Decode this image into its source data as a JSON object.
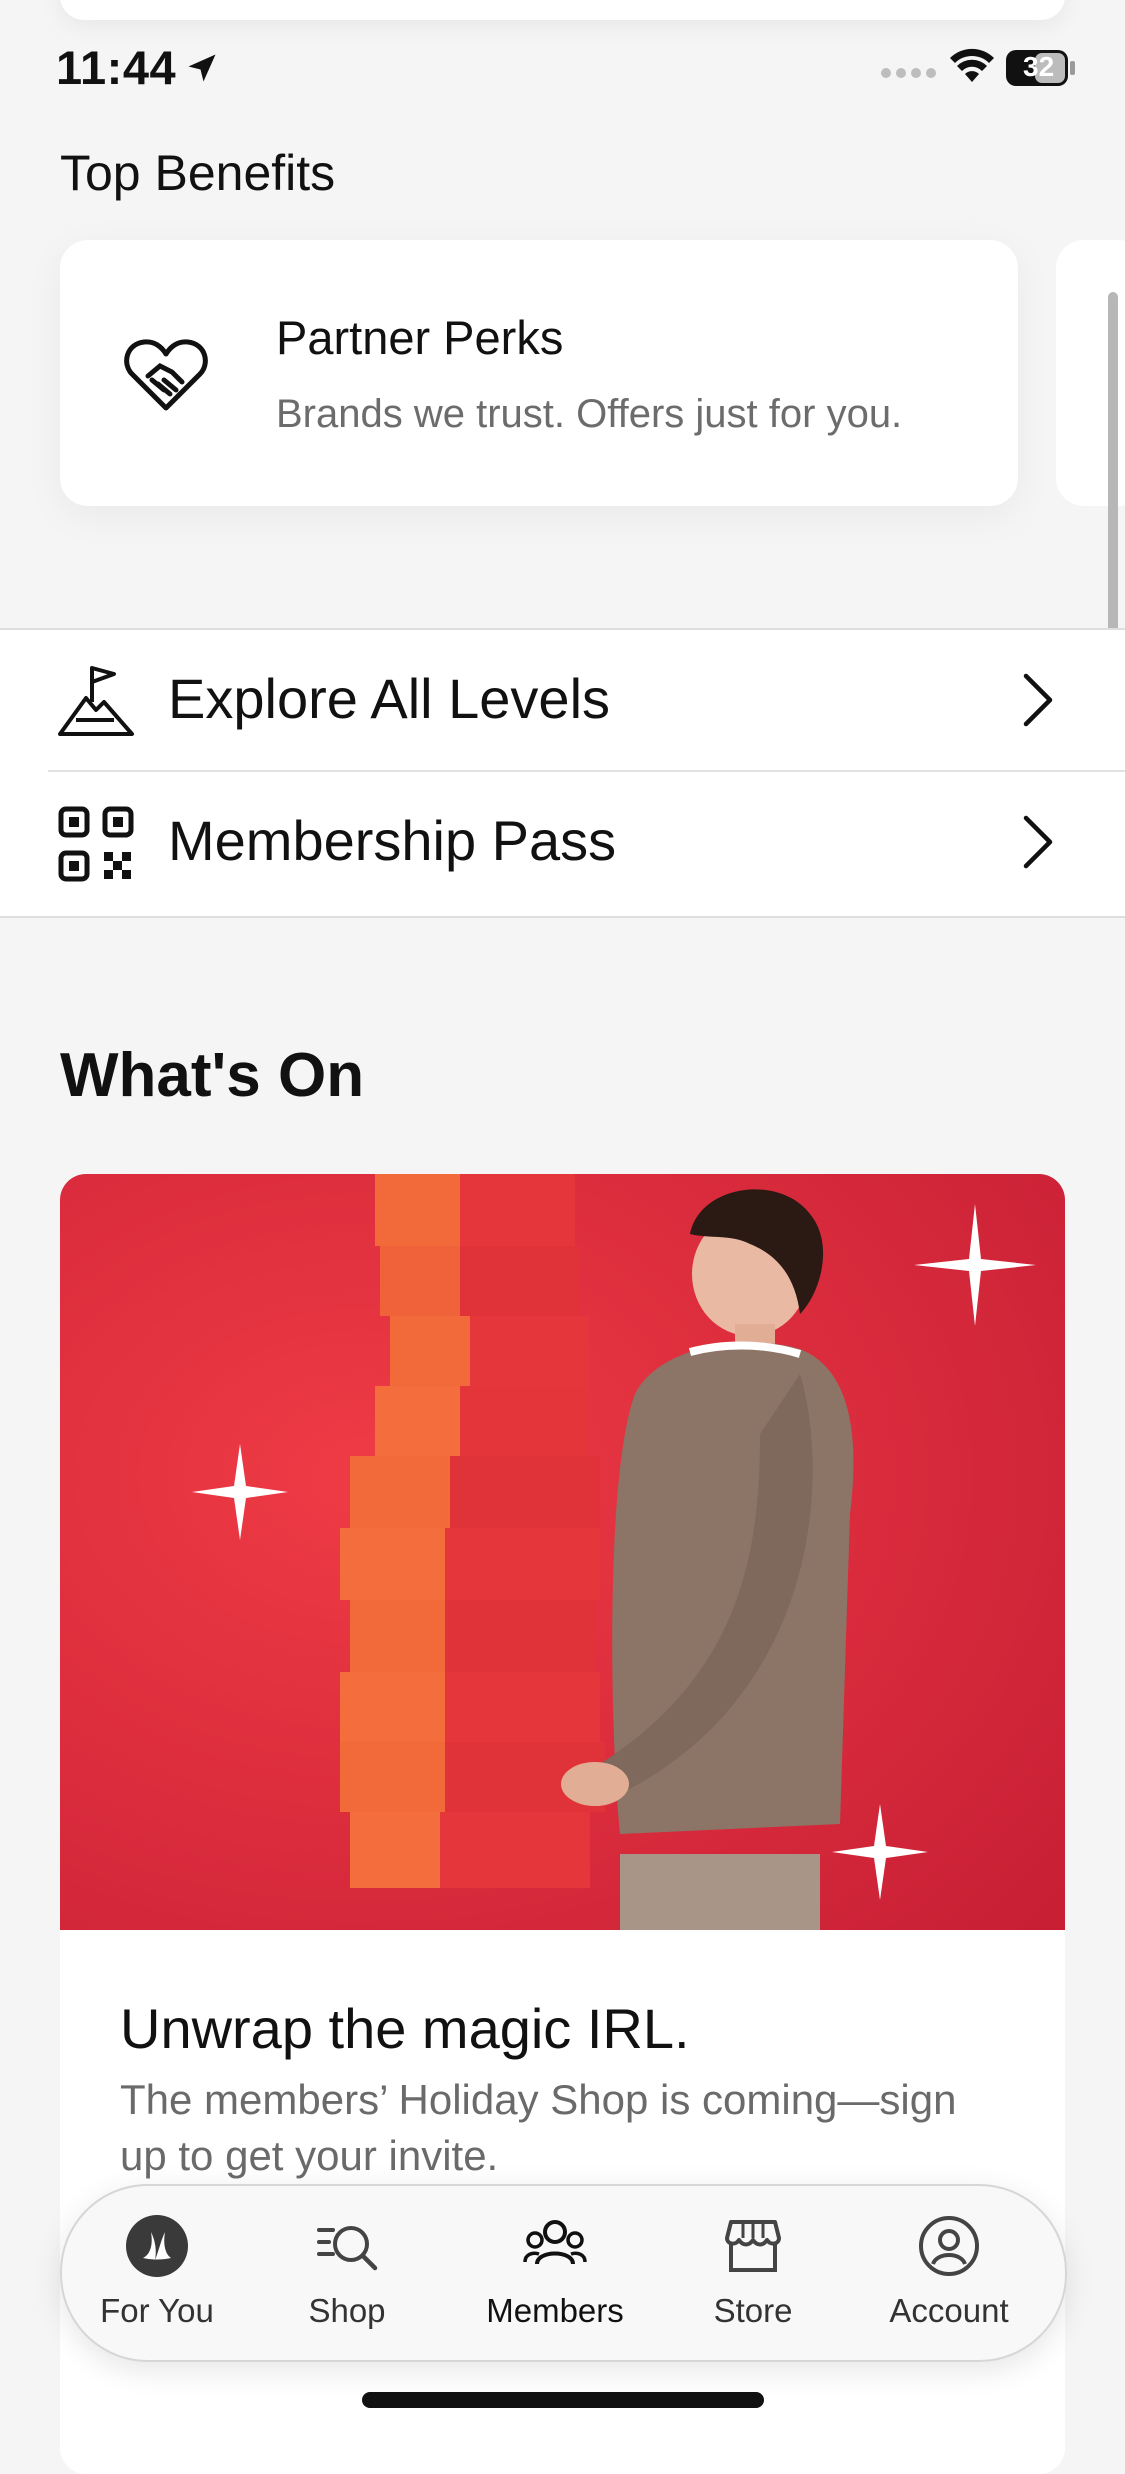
{
  "status_bar": {
    "time": "11:44",
    "battery": "32"
  },
  "top_benefits": {
    "title": "Top Benefits",
    "card": {
      "icon": "handshake-heart-icon",
      "title": "Partner Perks",
      "subtitle": "Brands we trust. Offers just for you."
    }
  },
  "links": [
    {
      "icon": "mountain-flag-icon",
      "label": "Explore All Levels"
    },
    {
      "icon": "qr-code-icon",
      "label": "Membership Pass"
    }
  ],
  "whats_on": {
    "title": "What's On",
    "card": {
      "title": "Unwrap the magic IRL.",
      "description": "The members’ Holiday Shop is coming—sign up to get your invite."
    }
  },
  "bottom_nav": {
    "items": [
      {
        "label": "For You",
        "icon": "lululemon-logo-icon",
        "active": false
      },
      {
        "label": "Shop",
        "icon": "search-list-icon",
        "active": false
      },
      {
        "label": "Members",
        "icon": "members-icon",
        "active": true
      },
      {
        "label": "Store",
        "icon": "store-icon",
        "active": false
      },
      {
        "label": "Account",
        "icon": "account-icon",
        "active": false
      }
    ]
  },
  "colors": {
    "accent_red": "#d62839",
    "box_orange": "#f26a3a",
    "background": "#f5f5f5"
  }
}
